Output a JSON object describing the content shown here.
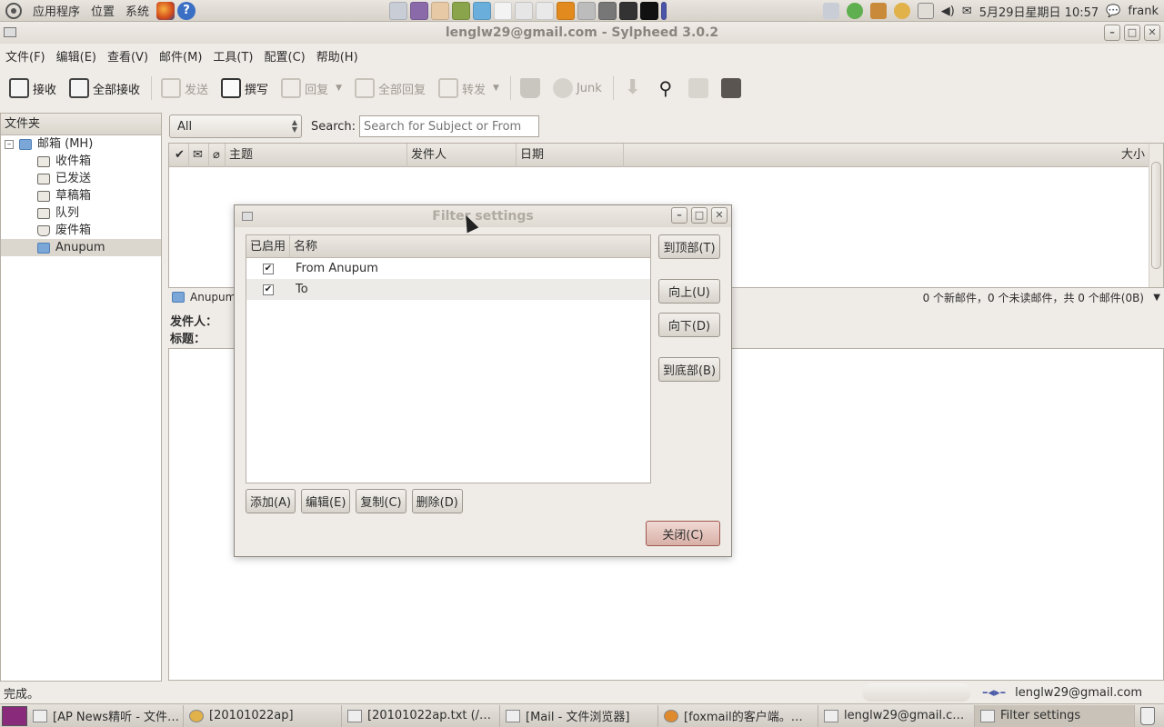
{
  "top_panel": {
    "menu": [
      "应用程序",
      "位置",
      "系统"
    ],
    "datetime": "5月29日星期日 10:57",
    "user": "frank"
  },
  "window": {
    "title": "lenglw29@gmail.com - Sylpheed 3.0.2"
  },
  "menubar": [
    "文件(F)",
    "编辑(E)",
    "查看(V)",
    "邮件(M)",
    "工具(T)",
    "配置(C)",
    "帮助(H)"
  ],
  "toolbar": {
    "receive": "接收",
    "receive_all": "全部接收",
    "send": "发送",
    "compose": "撰写",
    "reply": "回复",
    "reply_all": "全部回复",
    "forward": "转发",
    "junk": "Junk"
  },
  "folders": {
    "header": "文件夹",
    "root": "邮箱 (MH)",
    "items": [
      "收件箱",
      "已发送",
      "草稿箱",
      "队列",
      "废件箱",
      "Anupum"
    ]
  },
  "filter_bar": {
    "combo_value": "All",
    "search_label": "Search:",
    "search_placeholder": "Search for Subject or From"
  },
  "message_list": {
    "columns": [
      "主题",
      "发件人",
      "日期",
      "大小"
    ]
  },
  "status_line": {
    "folder": "Anupum",
    "counts": "0 个新邮件，0 个未读邮件，共 0 个邮件(0B)"
  },
  "message_view": {
    "from_label": "发件人：",
    "subject_label": "标题："
  },
  "bottom_status": {
    "text": "完成。",
    "account": "lenglw29@gmail.com"
  },
  "taskbar": [
    "[AP News精听 - 文件…",
    "[20101022ap]",
    "[20101022ap.txt (/…",
    "[Mail - 文件浏览器]",
    "[foxmail的客户端。…",
    "lenglw29@gmail.c…",
    "Filter settings"
  ],
  "dialog": {
    "title": "Filter settings",
    "col_enabled": "已启用",
    "col_name": "名称",
    "rules": [
      {
        "enabled": true,
        "name": "From Anupum"
      },
      {
        "enabled": true,
        "name": "To"
      }
    ],
    "btn_top": "到顶部(T)",
    "btn_up": "向上(U)",
    "btn_down": "向下(D)",
    "btn_bottom": "到底部(B)",
    "btn_add": "添加(A)",
    "btn_edit": "编辑(E)",
    "btn_copy": "复制(C)",
    "btn_delete": "删除(D)",
    "btn_close": "关闭(C)"
  }
}
